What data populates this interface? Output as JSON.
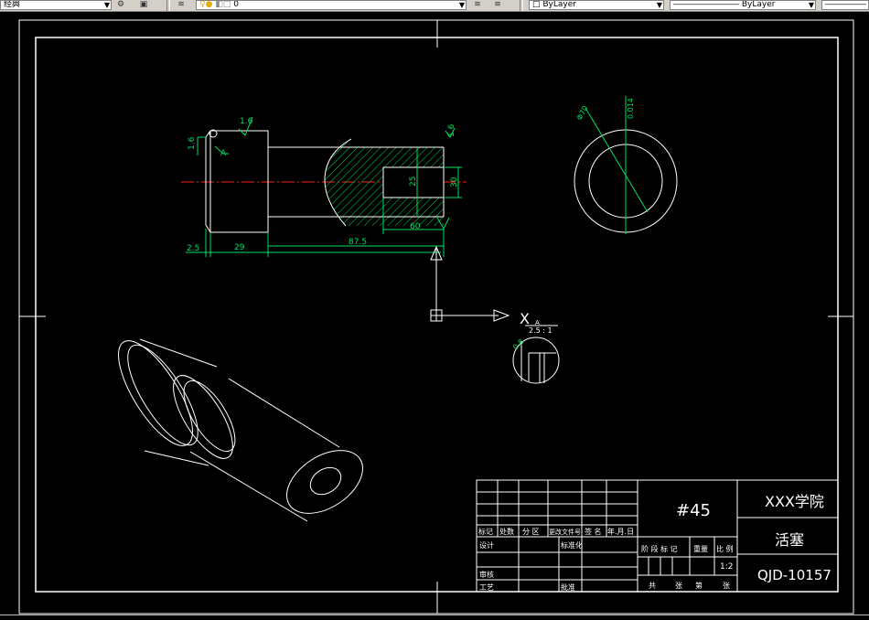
{
  "toolbar": {
    "workspace_value": "经典",
    "layer_value": "0",
    "color_value": "ByLayer",
    "linetype_value": "ByLayer"
  },
  "dims": {
    "rough_top": "1.6",
    "rough_left": "1.6",
    "rough_right": "1.6",
    "datum_a": "A",
    "d_25": "25",
    "d_30": "30",
    "d_60": "60",
    "d_2_5": "2.5",
    "d_29": "29",
    "d_87_5": "87.5",
    "circle_dia": "Φ70",
    "circle_tol": "0.014"
  },
  "view": {
    "x_label": "X",
    "a_label": "A",
    "detail_scale": "2.5 : 1",
    "detail_dim": "0.8"
  },
  "title_block": {
    "material": "#45",
    "school": "XXX学院",
    "part_name": "活塞",
    "drawing_no": "QJD-10157",
    "scale": "1:2",
    "row_headers": [
      "标记",
      "处数",
      "分 区",
      "更改文件号",
      "签 名",
      "年.月.日"
    ],
    "design": "设计",
    "standardize": "标准化",
    "review": "审核",
    "process": "工艺",
    "approve": "批准",
    "stage_mark": "阶 段 标 记",
    "weight": "重量",
    "ratio": "比 例",
    "total": "共",
    "sheet": "张",
    "no": "第",
    "sheet2": "张"
  }
}
